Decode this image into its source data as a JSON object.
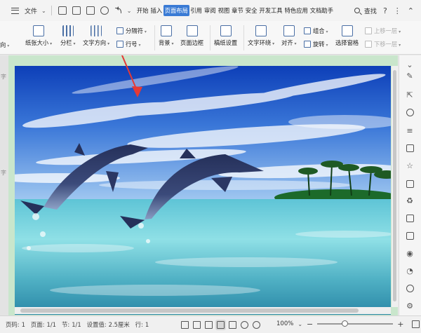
{
  "menubar": {
    "file_label": "文件",
    "tabs": [
      {
        "label": "开始",
        "active": false
      },
      {
        "label": "插入",
        "active": false
      },
      {
        "label": "页面布局",
        "active": true
      },
      {
        "label": "引用",
        "active": false
      },
      {
        "label": "审阅",
        "active": false
      },
      {
        "label": "视图",
        "active": false
      },
      {
        "label": "章节",
        "active": false
      },
      {
        "label": "安全",
        "active": false
      },
      {
        "label": "开发工具",
        "active": false
      },
      {
        "label": "特色应用",
        "active": false
      },
      {
        "label": "文档助手",
        "active": false
      }
    ],
    "search_label": "查找",
    "accent_color": "#3a7bd5"
  },
  "ribbon": {
    "margins_partial": "向",
    "paper_size": "纸张大小",
    "columns": "分栏",
    "text_direction": "文字方向",
    "separator": "分隔符",
    "line_number": "行号",
    "background": "背景",
    "page_border": "页面边框",
    "paper_setup": "稿纸设置",
    "text_wrap": "文字环绕",
    "align": "对齐",
    "group": "组合",
    "rotate": "旋转",
    "selection_pane": "选择窗格",
    "bring_forward": "上移一层",
    "send_backward": "下移一层"
  },
  "status": {
    "page_label": "页码:",
    "page_value": "1",
    "pages_label": "页面:",
    "pages_value": "1/1",
    "section_label": "节:",
    "section_value": "1/1",
    "setting_label": "设置值:",
    "setting_value": "2.5厘米",
    "line_label": "行:",
    "line_value": "1",
    "zoom_value": "100%",
    "zoom_level": 1.0
  },
  "leftstrip": {
    "chars": [
      "字",
      "字"
    ]
  }
}
